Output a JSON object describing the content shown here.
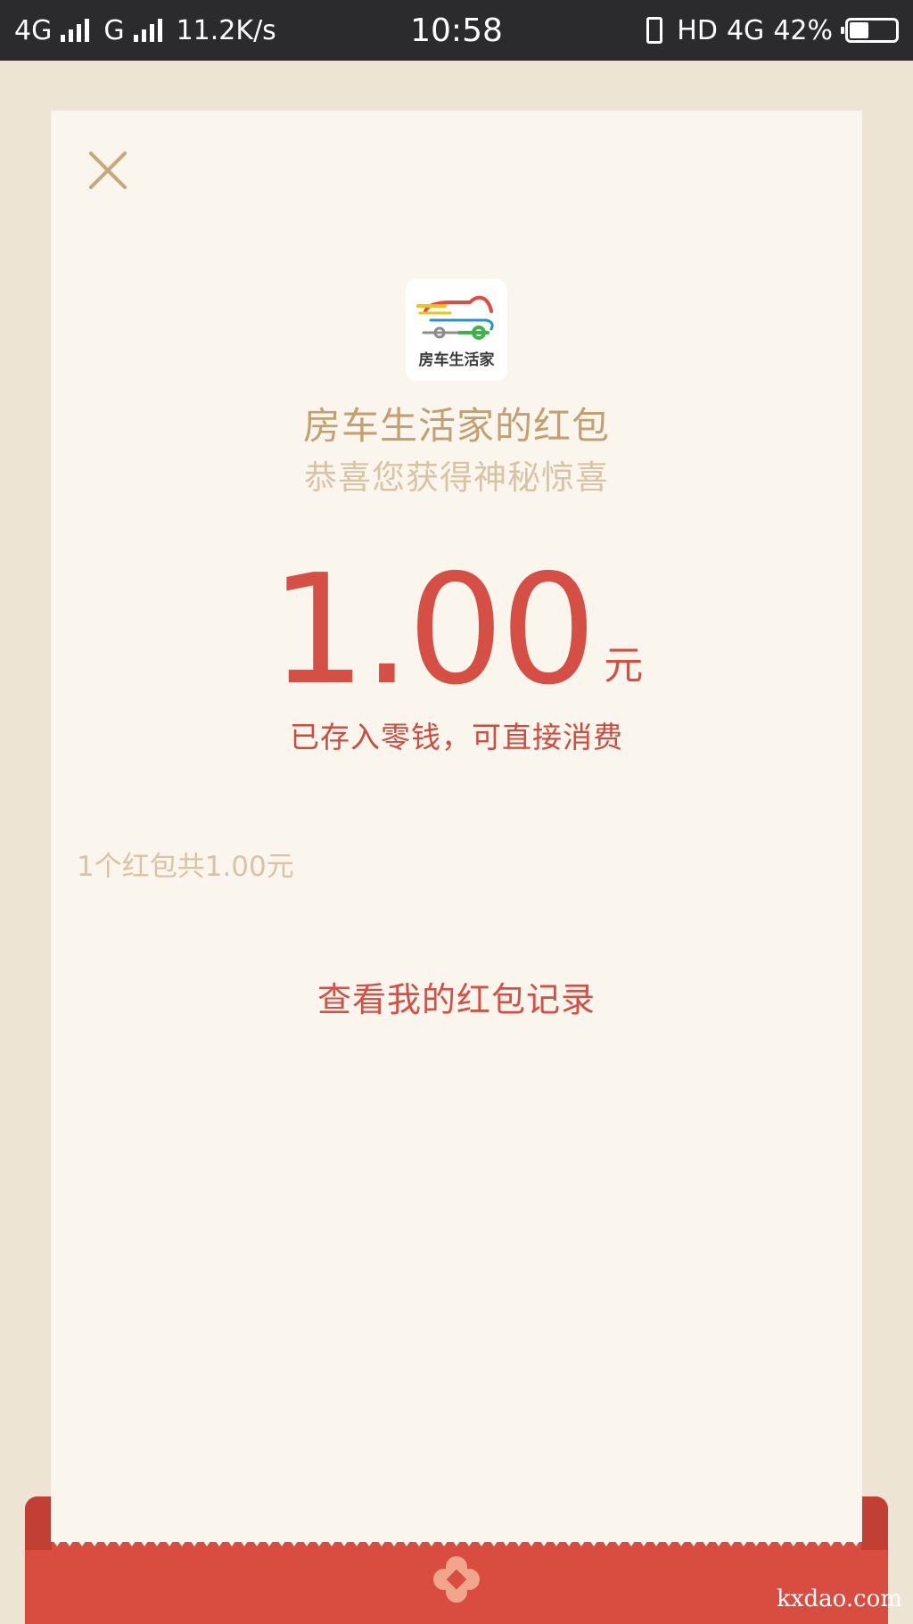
{
  "status_bar": {
    "network1": "4G",
    "network2": "G",
    "speed": "11.2K/s",
    "time": "10:58",
    "hd": "HD",
    "network3": "4G",
    "battery": "42%",
    "battery_level": 0.42,
    "icons": [
      "signal-icon",
      "vibrate-icon",
      "battery-icon"
    ]
  },
  "envelope": {
    "logo_text": "房车生活家",
    "title": "房车生活家的红包",
    "subtitle": "恭喜您获得神秘惊喜",
    "amount": "1.00",
    "unit": "元",
    "deposit_note": "已存入零钱，可直接消费",
    "summary": "1个红包共1.00元",
    "record_link": "查看我的红包记录",
    "icons": [
      "close-icon",
      "flower-icon"
    ]
  },
  "watermark": "kxdao.com",
  "colors": {
    "background": "#ede4d4",
    "card": "#fbf6ed",
    "gold": "#c2a072",
    "red": "#d64f44",
    "envelope_red": "#d94c40"
  }
}
